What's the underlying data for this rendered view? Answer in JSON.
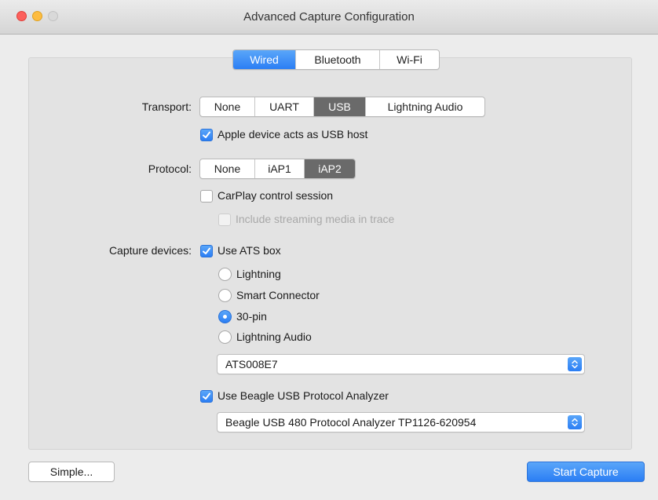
{
  "window": {
    "title": "Advanced Capture Configuration"
  },
  "tabs": {
    "items": [
      "Wired",
      "Bluetooth",
      "Wi-Fi"
    ],
    "selected": "Wired"
  },
  "transport": {
    "label": "Transport:",
    "options": [
      "None",
      "UART",
      "USB",
      "Lightning Audio"
    ],
    "selected": "USB",
    "usb_host_label": "Apple device acts as USB host",
    "usb_host_checked": true
  },
  "protocol": {
    "label": "Protocol:",
    "options": [
      "None",
      "iAP1",
      "iAP2"
    ],
    "selected": "iAP2",
    "carplay_label": "CarPlay control session",
    "carplay_checked": false,
    "streaming_label": "Include streaming media in trace",
    "streaming_checked": false,
    "streaming_enabled": false
  },
  "capture": {
    "label": "Capture devices:",
    "ats_label": "Use ATS box",
    "ats_checked": true,
    "ats_ports": [
      "Lightning",
      "Smart Connector",
      "30-pin",
      "Lightning Audio"
    ],
    "ats_port_selected": "30-pin",
    "ats_device": "ATS008E7",
    "beagle_label": "Use Beagle USB Protocol Analyzer",
    "beagle_checked": true,
    "beagle_device": "Beagle USB 480 Protocol Analyzer TP1126-620954"
  },
  "footer": {
    "simple_label": "Simple...",
    "start_label": "Start Capture"
  },
  "colors": {
    "accent": "#2b7ef4",
    "selected_dark": "#6a6a6a",
    "window_bg": "#ececec",
    "panel_bg": "#e3e3e3"
  }
}
